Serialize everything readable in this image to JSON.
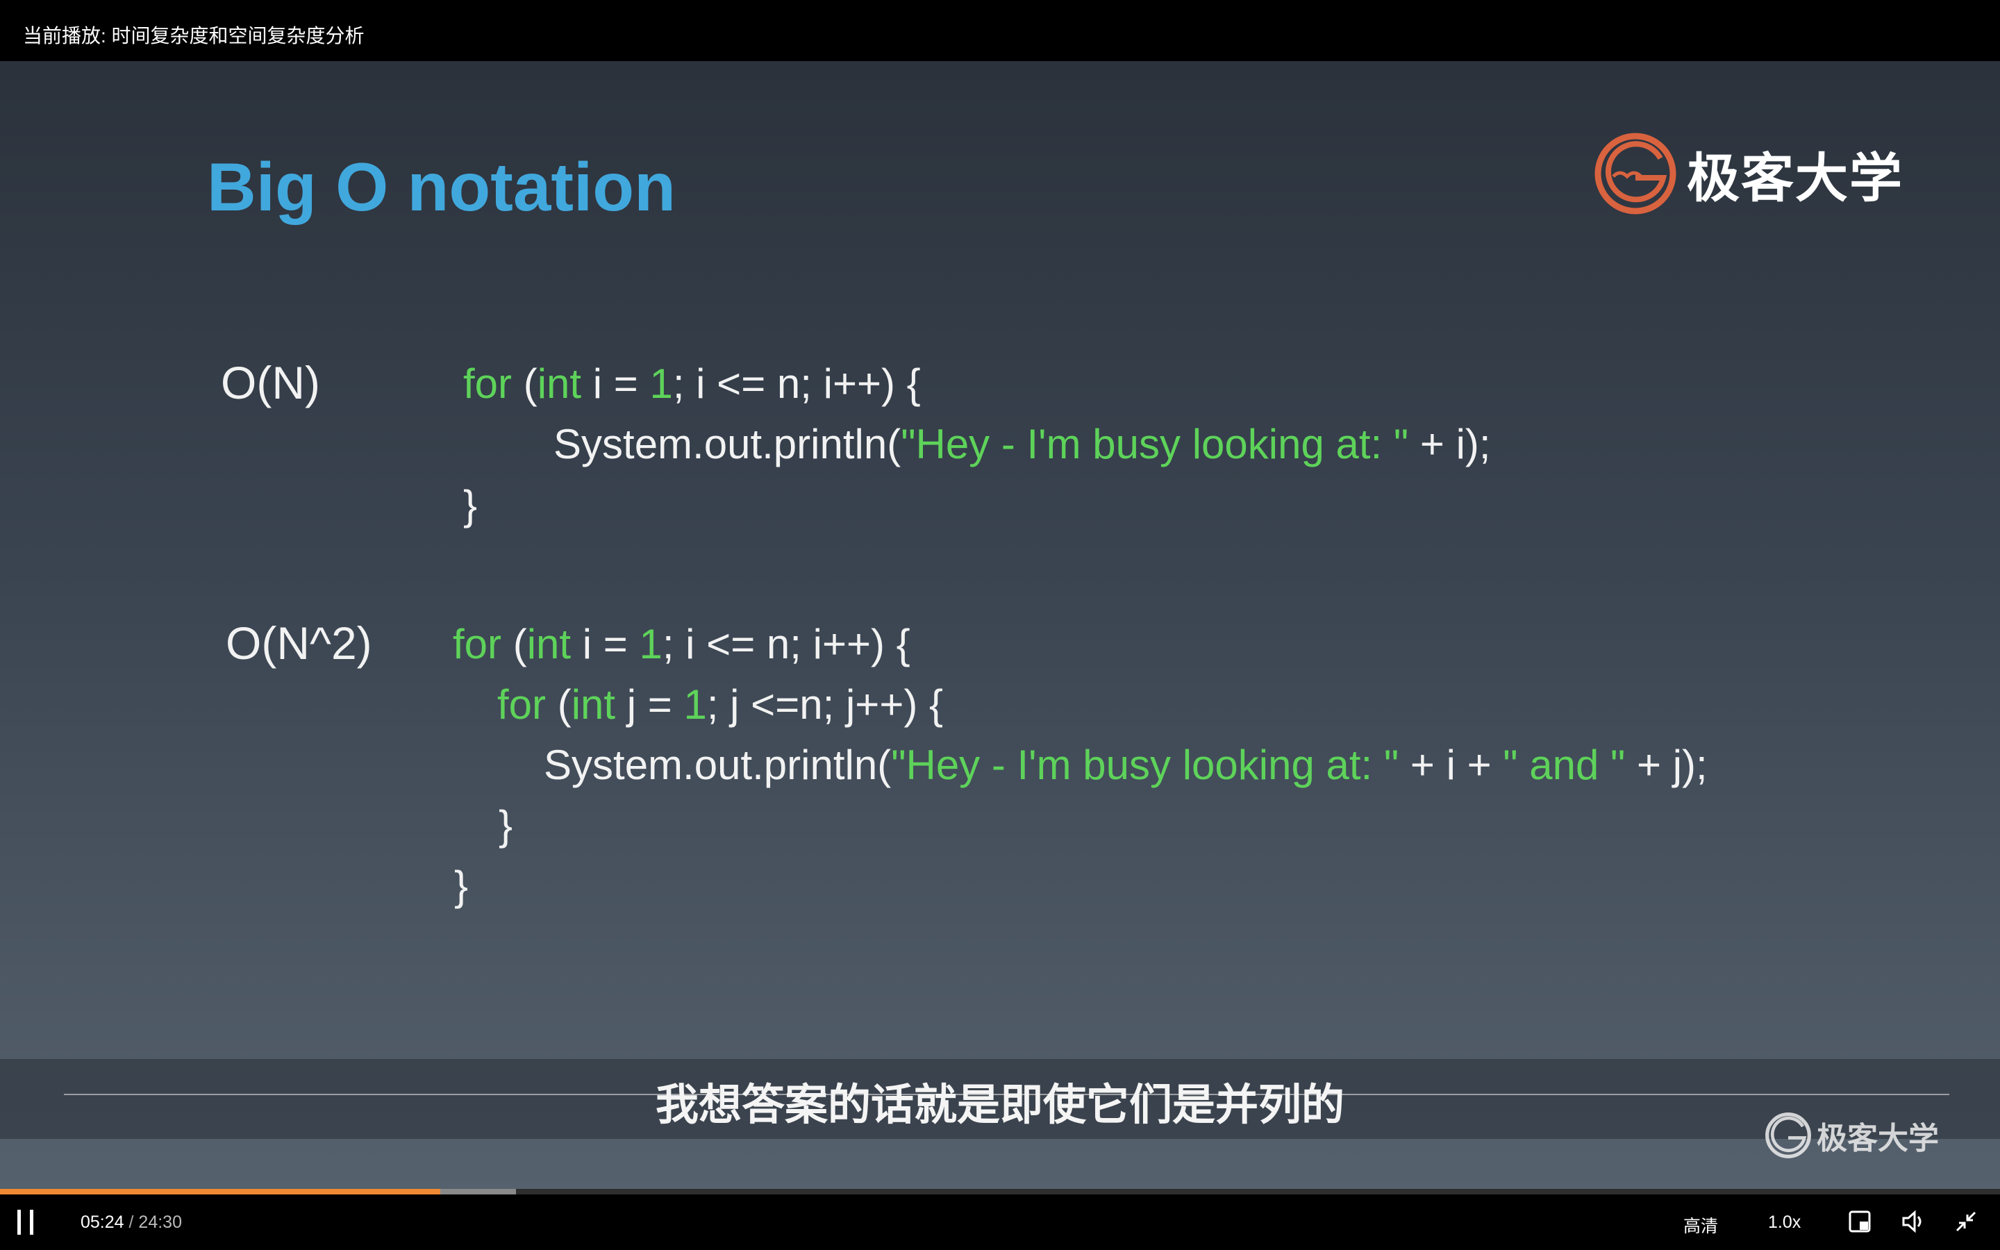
{
  "header": {
    "now_playing": "当前播放: 时间复杂度和空间复杂度分析"
  },
  "slide": {
    "title": "Big O notation",
    "logo_text": "极客大学",
    "block1": {
      "label": "O(N)",
      "lines": [
        [
          [
            "for",
            "g"
          ],
          [
            " (",
            ""
          ],
          [
            "int",
            "g"
          ],
          [
            " i = ",
            ""
          ],
          [
            "1",
            "g"
          ],
          [
            "; i <= n; i++) {",
            ""
          ]
        ],
        [
          [
            "System.out.println(",
            ""
          ],
          [
            "\"Hey - I'm busy looking at: \"",
            "g"
          ],
          [
            " + i);",
            ""
          ]
        ],
        [
          [
            "}",
            ""
          ]
        ]
      ]
    },
    "block2": {
      "label": "O(N^2)",
      "lines": [
        [
          [
            "for",
            "g"
          ],
          [
            " (",
            ""
          ],
          [
            "int",
            "g"
          ],
          [
            " i = ",
            ""
          ],
          [
            "1",
            "g"
          ],
          [
            "; i <= n; i++) {",
            ""
          ]
        ],
        [
          [
            "for",
            "g"
          ],
          [
            " (",
            ""
          ],
          [
            "int",
            "g"
          ],
          [
            " j = ",
            ""
          ],
          [
            "1",
            "g"
          ],
          [
            "; j <=n; j++) {",
            ""
          ]
        ],
        [
          [
            "System.out.println(",
            ""
          ],
          [
            "\"Hey - I'm busy looking at: \"",
            "g"
          ],
          [
            " + i + ",
            ""
          ],
          [
            "\" and \"",
            "g"
          ],
          [
            " + j);",
            ""
          ]
        ],
        [
          [
            "}",
            ""
          ]
        ],
        [
          [
            "}",
            ""
          ]
        ]
      ]
    },
    "colors": {
      "title": "#41a8dd",
      "keyword_string": "#5ed35a",
      "logo": "#d9633f"
    }
  },
  "subtitle": "我想答案的话就是即使它们是并列的",
  "watermark": "极客大学",
  "player": {
    "current_time": "05:24",
    "separator": "/",
    "duration": "24:30",
    "progress_percent": 22.0,
    "buffered_percent": 25.8,
    "quality": "高清",
    "speed": "1.0x",
    "icons": [
      "pause-icon",
      "picture-in-picture-icon",
      "volume-icon",
      "exit-fullscreen-icon"
    ]
  }
}
